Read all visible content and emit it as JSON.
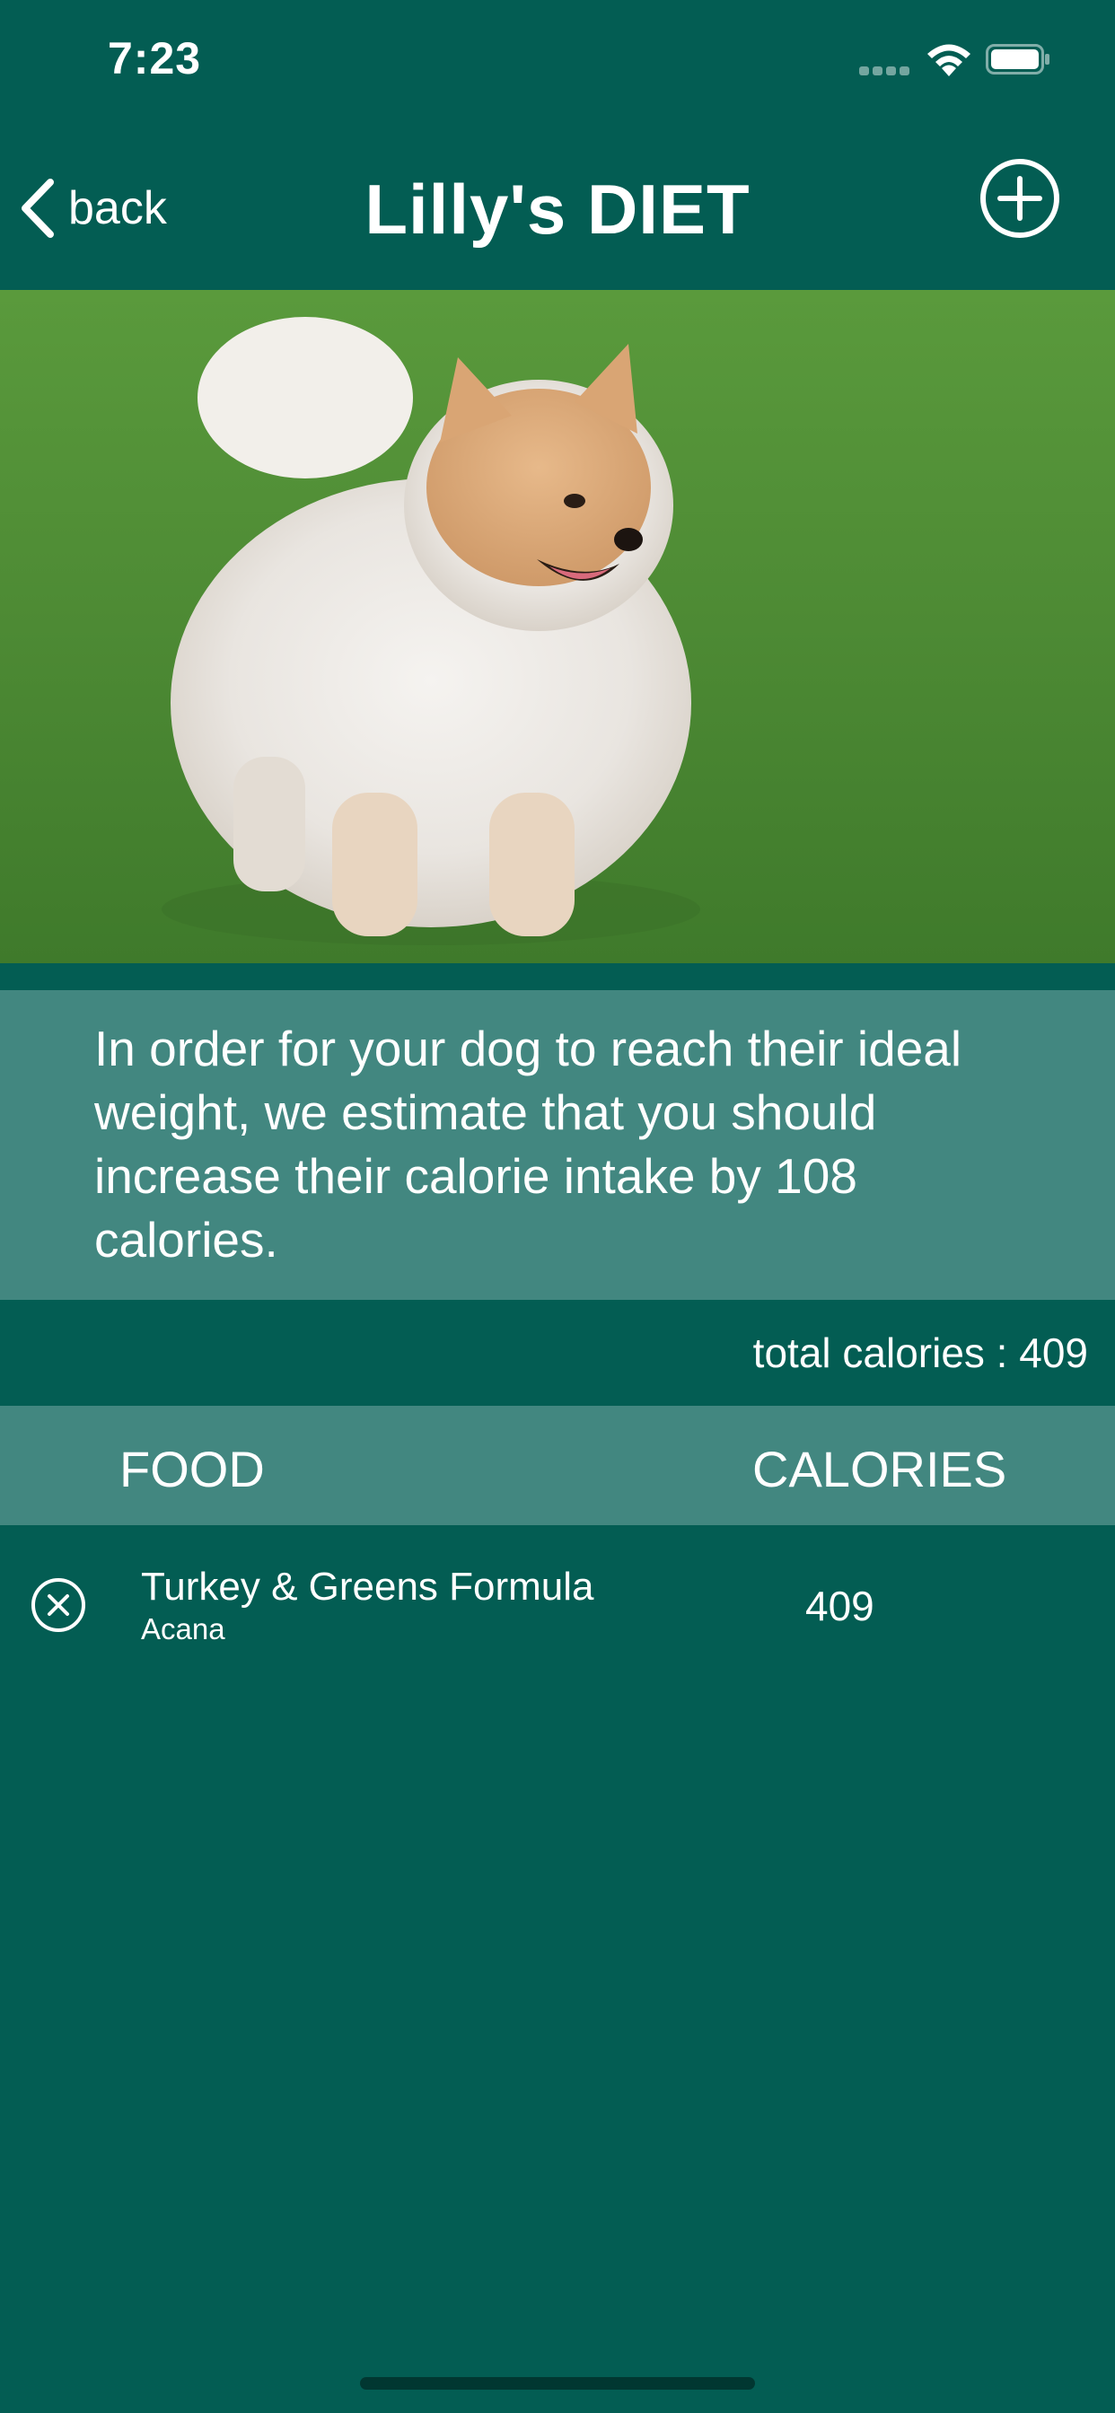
{
  "status_bar": {
    "time": "7:23",
    "icons": [
      "cellular-signal-icon",
      "wifi-icon",
      "battery-icon"
    ]
  },
  "nav": {
    "back_label": "back",
    "title": "Lilly's DIET",
    "add_icon": "plus-circle-icon"
  },
  "hero_image": {
    "subject": "pomeranian-dog-photo"
  },
  "message": {
    "text": "In order for your dog to reach their ideal weight, we estimate that you should increase their calorie intake by 108 calories."
  },
  "totals": {
    "label": "total calories : 409"
  },
  "table": {
    "headers": {
      "food": "FOOD",
      "calories": "CALORIES"
    },
    "rows": [
      {
        "name": "Turkey & Greens Formula",
        "brand": "Acana",
        "calories": "409",
        "remove_icon": "remove-circle-x-icon"
      }
    ]
  },
  "colors": {
    "background": "#035d53",
    "panel": "#428780",
    "text": "#ffffff"
  }
}
